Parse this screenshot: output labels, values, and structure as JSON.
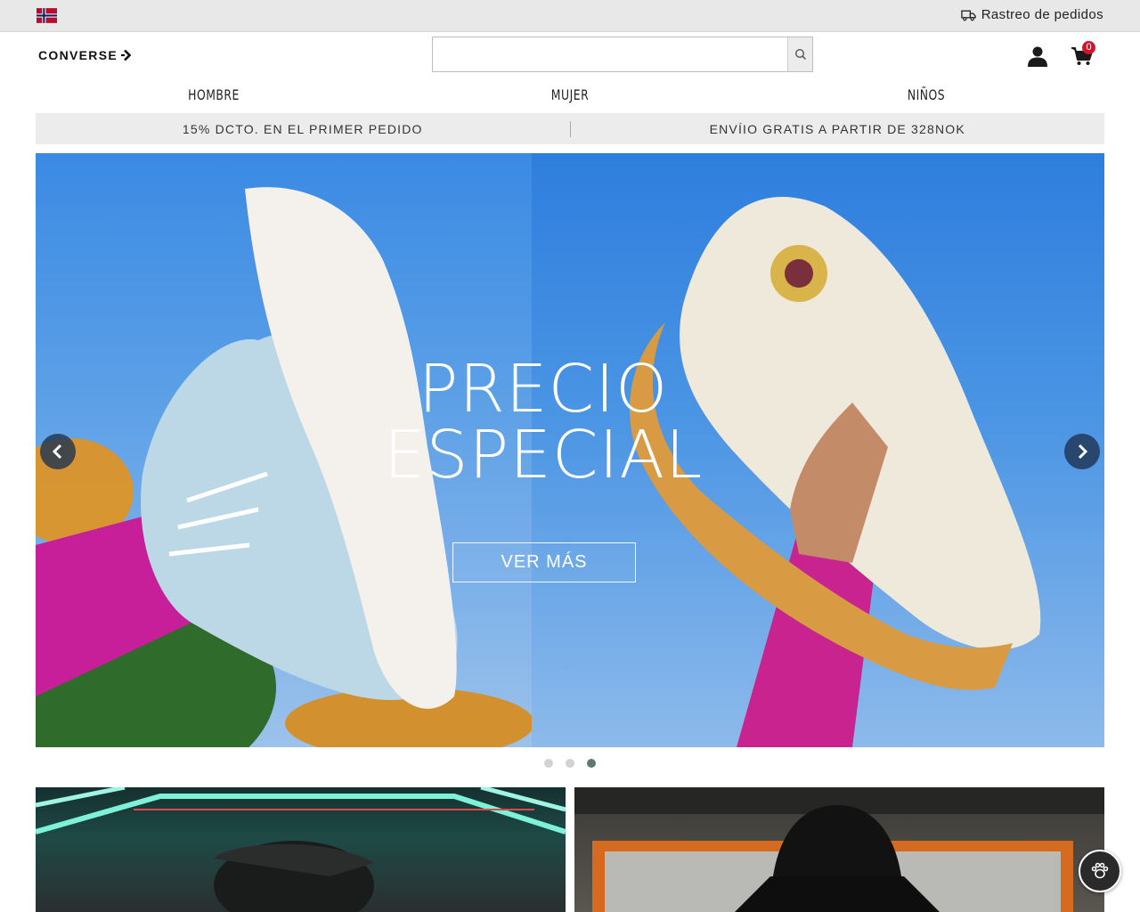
{
  "topbar": {
    "flag_icon": "norway-flag-icon",
    "tracking_label": "Rastreo de pedidos",
    "tracking_icon": "truck-icon"
  },
  "header": {
    "logo_text": "CONVERSE",
    "search": {
      "value": "",
      "placeholder": ""
    },
    "cart_count": "0"
  },
  "nav": {
    "items": [
      {
        "label": "HOMBRE"
      },
      {
        "label": "MUJER"
      },
      {
        "label": "NIÑOS"
      }
    ]
  },
  "promo": {
    "items": [
      {
        "label": "15% DCTO. EN EL PRIMER PEDIDO"
      },
      {
        "label": "ENVÍIO GRATIS A PARTIR DE 328NOK"
      }
    ]
  },
  "hero": {
    "title_line1": "PRECIO",
    "title_line2": "ESPECIAL",
    "cta_label": "VER MÁS",
    "slide_count": 3,
    "active_slide": 3
  },
  "colors": {
    "promo_bg": "#ececec",
    "cart_badge": "#d3142c",
    "hero_blue": "#4d8fd9"
  }
}
